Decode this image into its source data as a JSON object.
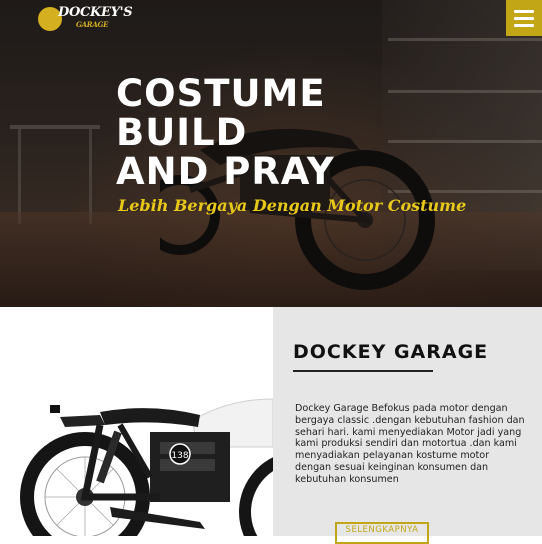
{
  "brand": {
    "logo_text": "DOCKEY'S",
    "logo_sub": "GARAGE"
  },
  "menu": {
    "icon": "hamburger-menu-icon"
  },
  "hero": {
    "title_lines": [
      "COSTUME",
      "BUILD",
      "AND PRAY"
    ],
    "tagline": "Lebih Bergaya Dengan Motor Costume"
  },
  "about": {
    "title": "DOCKEY GARAGE",
    "text": "Dockey Garage Befokus pada motor dengan bergaya classic .dengan kebutuhan fashion dan sehari hari. kami menyediakan Motor jadi yang kami produksi sendiri dan motortua .dan kami menyadiakan pelayanan kostume motor dengan sesuai keinginan konsumen dan kebutuhan konsumen",
    "button_label": "SELENGKAPNYA",
    "bike_plate": "138"
  },
  "colors": {
    "accent": "#c2a615",
    "tagline": "#e8c81a",
    "panel": "#e6e6e6"
  }
}
